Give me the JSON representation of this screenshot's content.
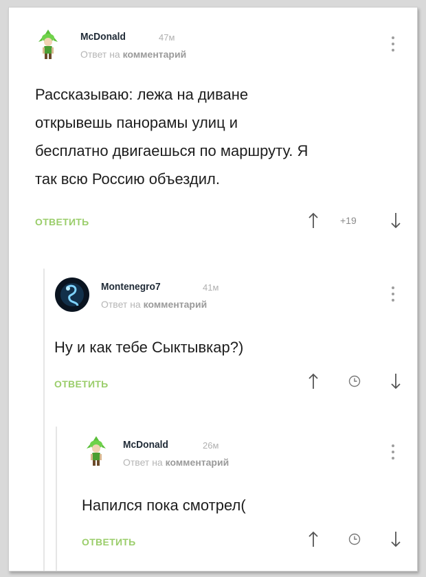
{
  "comments": [
    {
      "username": "McDonald",
      "time": "47м",
      "reply_prefix": "Ответ на",
      "reply_target": "комментарий",
      "lines": [
        "Рассказываю: лежа на диване",
        "открывешь панорамы улиц и",
        "бесплатно двигаешься по маршруту. Я",
        "так всю Россию объездил."
      ],
      "reply_label": "ОТВЕТИТЬ",
      "score": "+19"
    },
    {
      "username": "Montenegro7",
      "time": "41м",
      "reply_prefix": "Ответ на",
      "reply_target": "комментарий",
      "lines": [
        "Ну и как тебе Сыктывкар?)"
      ],
      "reply_label": "ОТВЕТИТЬ"
    },
    {
      "username": "McDonald",
      "time": "26м",
      "reply_prefix": "Ответ на",
      "reply_target": "комментарий",
      "lines": [
        "Напился пока смотрел("
      ],
      "reply_label": "ОТВЕТИТЬ"
    }
  ],
  "colors": {
    "reply_button": "#9acd6a",
    "thread_line": "#e6e6e6",
    "text": "#1d1d1d"
  },
  "icons": [
    "kebab-menu-icon",
    "upvote-arrow-icon",
    "downvote-arrow-icon",
    "clock-icon"
  ]
}
